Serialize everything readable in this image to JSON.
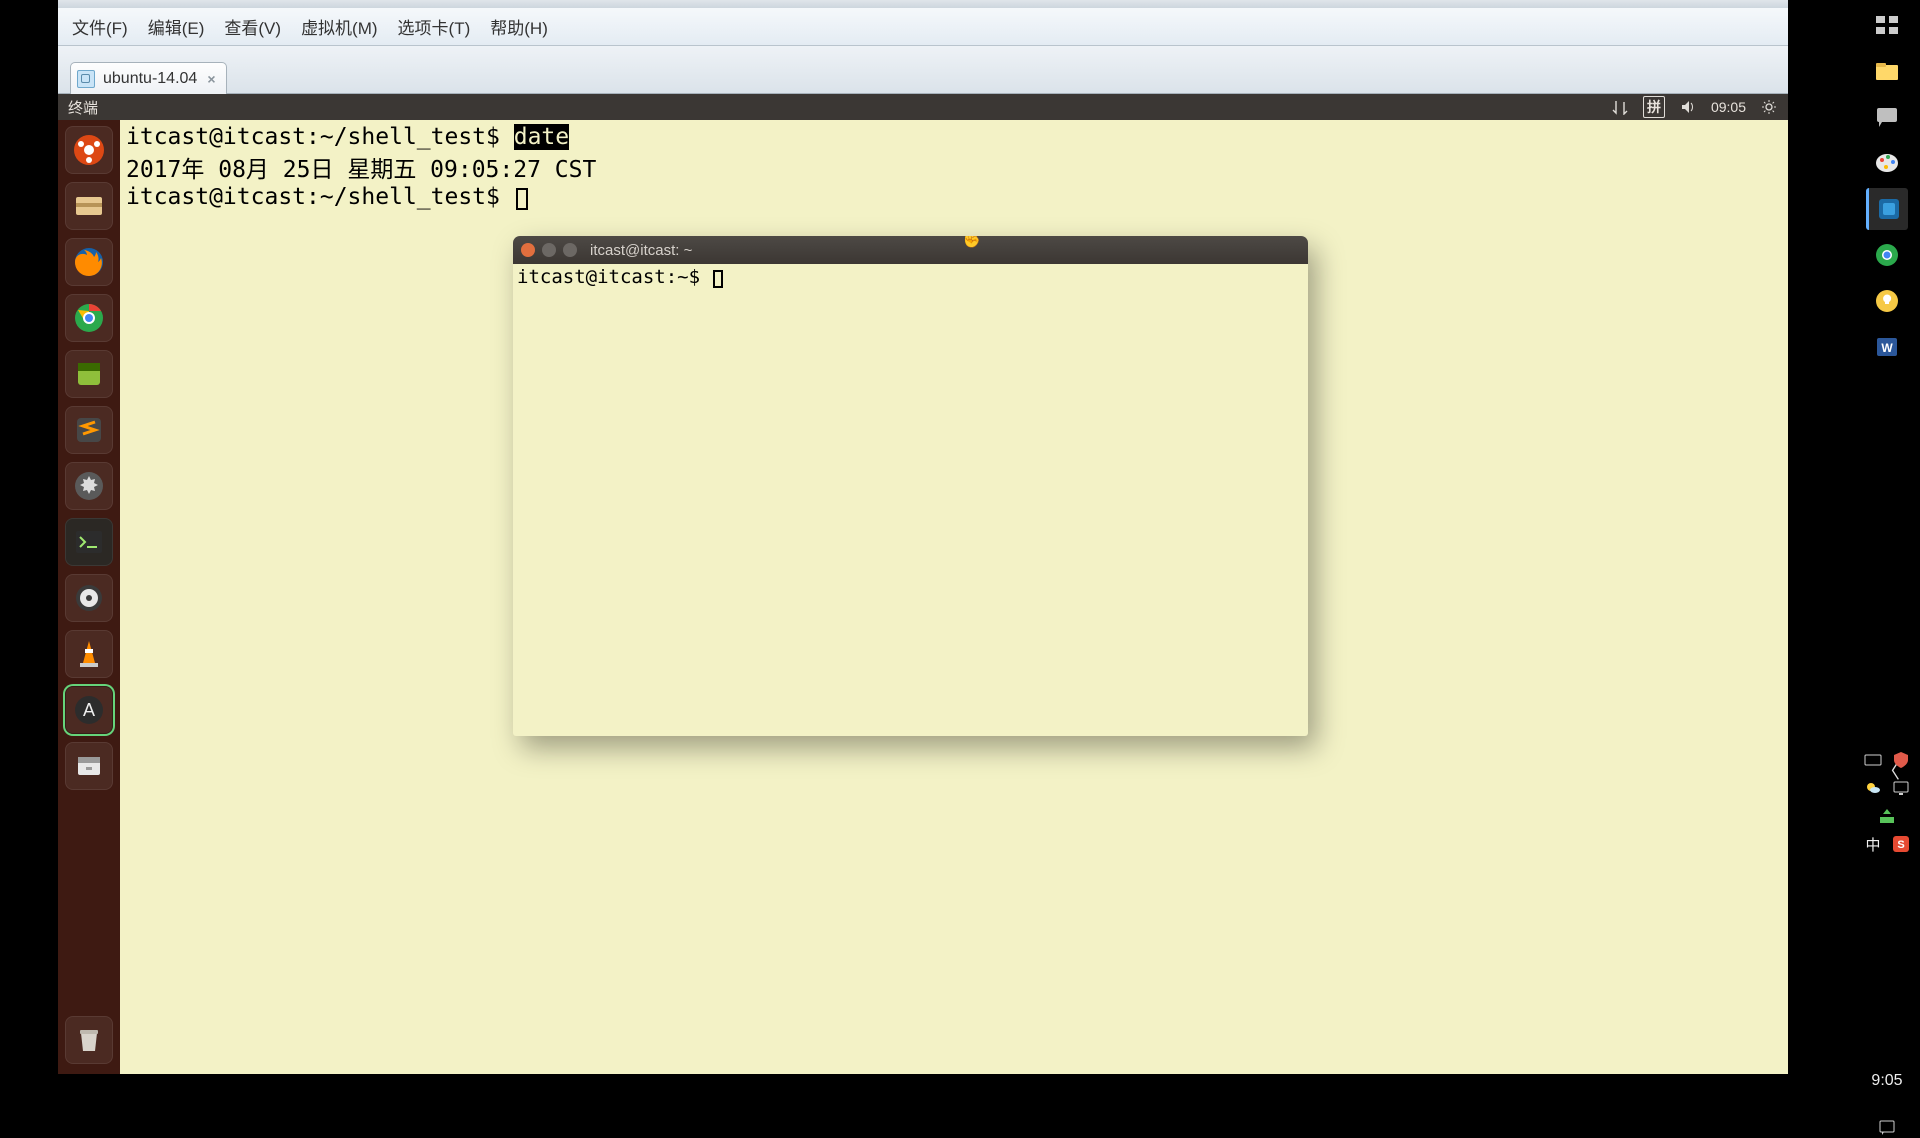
{
  "vm_menubar": {
    "items": [
      "文件(F)",
      "编辑(E)",
      "查看(V)",
      "虚拟机(M)",
      "选项卡(T)",
      "帮助(H)"
    ]
  },
  "vm_tab": {
    "label": "ubuntu-14.04",
    "close": "×"
  },
  "ubuntu_panel": {
    "left_label": "终端",
    "ime": "拼",
    "time": "09:05"
  },
  "launcher_items": [
    "dash",
    "files",
    "firefox",
    "chrome",
    "book",
    "sublime",
    "settings-tools",
    "terminal",
    "system-monitor",
    "vlc",
    "software-updater",
    "archive"
  ],
  "trash_label": "trash",
  "bg_terminal": {
    "line1_prompt": "itcast@itcast:~/shell_test$ ",
    "line1_cmd": "date",
    "line2_output": "2017年 08月 25日 星期五 09:05:27 CST",
    "line3_prompt": "itcast@itcast:~/shell_test$ "
  },
  "float_terminal": {
    "title": "itcast@itcast: ~",
    "prompt": "itcast@itcast:~$ "
  },
  "win_taskbar_items": [
    "task-view",
    "file-explorer",
    "chat",
    "paint",
    "vmware",
    "chrome",
    "tips",
    "word",
    "sogou"
  ],
  "win_tray": {
    "expand": "〈",
    "ime_lang": "中",
    "clock": "9:05"
  }
}
